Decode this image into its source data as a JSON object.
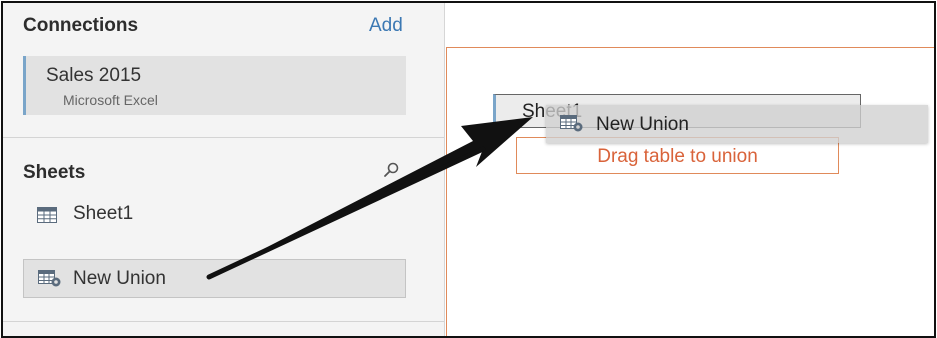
{
  "connections": {
    "title": "Connections",
    "add_label": "Add",
    "items": [
      {
        "name": "Sales 2015",
        "type": "Microsoft Excel"
      }
    ]
  },
  "sheets": {
    "title": "Sheets",
    "search_icon": "search-icon",
    "items": [
      {
        "label": "Sheet1",
        "icon": "table-grid-icon"
      }
    ],
    "union_item": {
      "label": "New Union",
      "icon": "union-table-icon"
    }
  },
  "canvas": {
    "sheet_box_label": "Sheet1",
    "drop_zone_label": "Drag table to union",
    "drag_ghost_label": "New Union"
  },
  "colors": {
    "accent_blue": "#3b78b3",
    "selection_bar": "#7aa5c9",
    "drop_orange": "#d9633a",
    "panel_bg": "#f4f4f4"
  }
}
